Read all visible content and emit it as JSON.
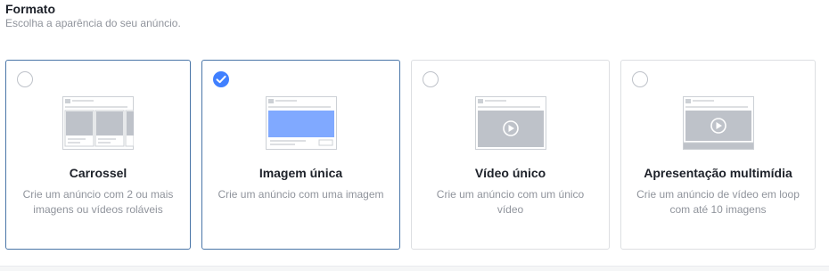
{
  "section": {
    "title": "Formato",
    "subtitle": "Escolha a aparência do seu anúncio."
  },
  "formats": [
    {
      "title": "Carrossel",
      "description": "Crie um anúncio com 2 ou mais imagens ou vídeos roláveis",
      "selected": false,
      "icon": "carousel-preview-icon"
    },
    {
      "title": "Imagem única",
      "description": "Crie um anúncio com uma imagem",
      "selected": true,
      "icon": "single-image-preview-icon"
    },
    {
      "title": "Vídeo único",
      "description": "Crie um anúncio com um único vídeo",
      "selected": false,
      "icon": "single-video-preview-icon"
    },
    {
      "title": "Apresentação multimídia",
      "description": "Crie um anúncio de vídeo em loop com até 10 imagens",
      "selected": false,
      "icon": "slideshow-preview-icon"
    }
  ],
  "colors": {
    "accent": "#4080ff",
    "selected_border": "#4a76a8",
    "border": "#dddfe2",
    "muted_text": "#90949c",
    "title_text": "#1d2129"
  }
}
